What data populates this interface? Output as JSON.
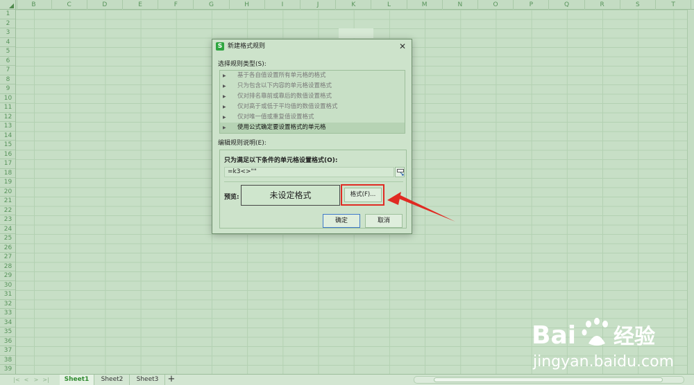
{
  "spreadsheet": {
    "columns": [
      "B",
      "C",
      "D",
      "E",
      "F",
      "G",
      "H",
      "I",
      "J",
      "K",
      "L",
      "M",
      "N",
      "O",
      "P",
      "Q",
      "R",
      "S",
      "T"
    ],
    "rows": [
      "1",
      "2",
      "3",
      "4",
      "5",
      "6",
      "7",
      "8",
      "9",
      "10",
      "11",
      "12",
      "13",
      "14",
      "15",
      "16",
      "17",
      "18",
      "19",
      "20",
      "21",
      "22",
      "23",
      "24",
      "25",
      "26",
      "27",
      "28",
      "29",
      "30",
      "31",
      "32",
      "33",
      "34",
      "35",
      "36",
      "37",
      "38",
      "39"
    ]
  },
  "sheets": [
    "Sheet1",
    "Sheet2",
    "Sheet3"
  ],
  "active_sheet": "Sheet1",
  "add_sheet_label": "+",
  "dialog": {
    "title": "新建格式规则",
    "app_icon": "S",
    "close_label": "✕",
    "rule_type_label": "选择规则类型(S):",
    "rule_types": [
      "基于各自值设置所有单元格的格式",
      "只为包含以下内容的单元格设置格式",
      "仅对排名靠前或靠后的数值设置格式",
      "仅对高于或低于平均值的数值设置格式",
      "仅对唯一值或重复值设置格式",
      "使用公式确定要设置格式的单元格"
    ],
    "selected_rule_index": 5,
    "edit_label": "编辑规则说明(E):",
    "condition_label": "只为满足以下条件的单元格设置格式(O):",
    "formula_value": "=k3<>\"\"",
    "preview_label": "预览:",
    "preview_text": "未设定格式",
    "format_button": "格式(F)...",
    "ok_button": "确定",
    "cancel_button": "取消"
  },
  "watermark": {
    "logo_text": "Bai 经验",
    "url": "jingyan.baidu.com"
  },
  "colors": {
    "accent_highlight": "#e02a22",
    "app_icon": "#2fa640",
    "active_sheet_text": "#2f8a2f"
  }
}
